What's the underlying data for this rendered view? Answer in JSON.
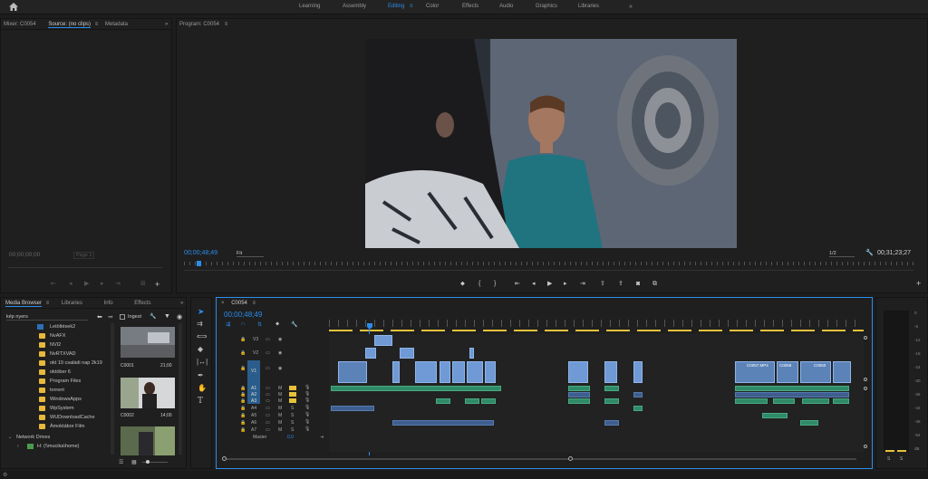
{
  "workspaces": [
    "Learning",
    "Assembly",
    "Editing",
    "Color",
    "Effects",
    "Audio",
    "Graphics",
    "Libraries"
  ],
  "workspace_active": "Editing",
  "source_panel": {
    "tabs": [
      "Mixer: C0054",
      "Source: (no clips)",
      "Metadata"
    ],
    "timecode": "00;00;00;00",
    "page": "Page 1"
  },
  "program_panel": {
    "title": "Program: C0054",
    "timecode": "00;00;48;49",
    "fit": "Fit",
    "quality": "1/2",
    "duration": "00;31;23;27"
  },
  "media_panel": {
    "tabs": [
      "Media Browser",
      "Libraries",
      "Info",
      "Effects"
    ],
    "location": "kép nyers",
    "ingest_label": "Ingest",
    "tree": [
      "Letöltések2",
      "NvAFX",
      "NVI2",
      "NvRTXVAD",
      "okt 19 családi nap 2k19",
      "október 6",
      "Program Files",
      "torrent",
      "WindowsApps",
      "WpSystem",
      "WUDownloadCache",
      "Ámoktábor Film"
    ],
    "network_drives": "Network Drives",
    "network_item": "H: (\\\\mucika\\home)",
    "clips": [
      {
        "name": "C0001",
        "dur": "21;00"
      },
      {
        "name": "C0002",
        "dur": "14;00"
      }
    ]
  },
  "timeline": {
    "sequence": "C0054",
    "timecode": "00;00;48;49",
    "video_tracks": [
      "V3",
      "V2",
      "V1"
    ],
    "audio_tracks": [
      "A1",
      "A2",
      "A3",
      "A4",
      "A5",
      "A6",
      "A7"
    ],
    "master": "Master",
    "master_value": "0,0",
    "clip_labels": [
      "C0057.MP4",
      "C0058",
      "C0060"
    ]
  },
  "meters": [
    "0",
    "-6",
    "-12",
    "-18",
    "-24",
    "-30",
    "-36",
    "-42",
    "-48",
    "-54",
    "dB"
  ],
  "colors": {
    "accent": "#2d8ceb",
    "video_clip": "#6f9ad6",
    "audio_clip": "#2f8a68",
    "sync_yellow": "#e6c23a"
  }
}
